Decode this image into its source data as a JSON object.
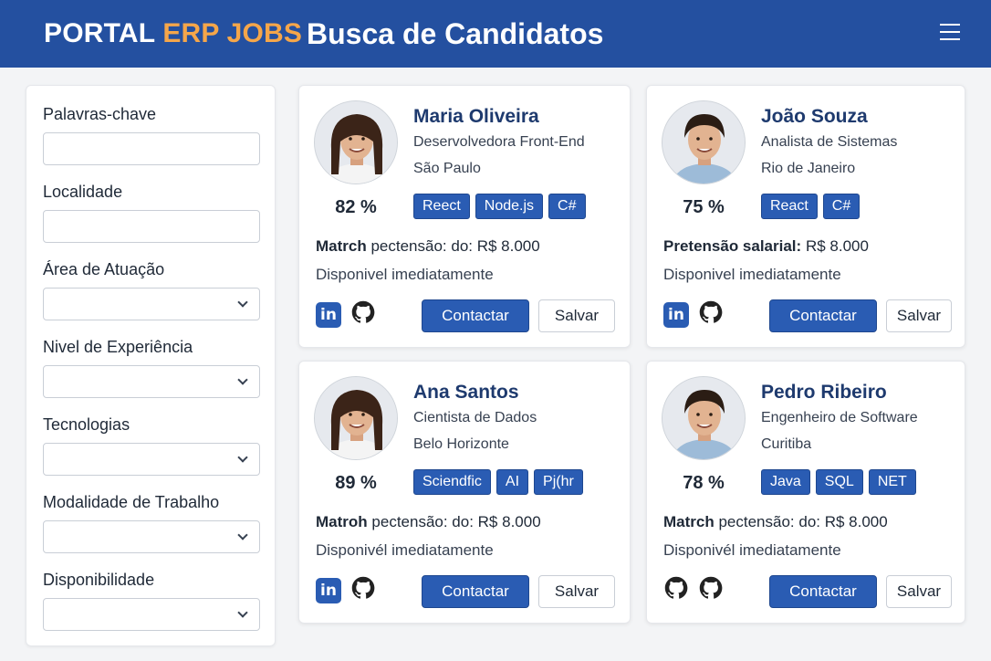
{
  "header": {
    "brand_part1": "PORTAL",
    "brand_part2": "ERP JOBS",
    "title": "Busca de Candidatos",
    "menu_icon": "hamburger-menu-icon"
  },
  "filters": [
    {
      "label": "Palavras-chave",
      "type": "text",
      "value": ""
    },
    {
      "label": "Localidade",
      "type": "text",
      "value": ""
    },
    {
      "label": "Área de Atuação",
      "type": "select",
      "value": ""
    },
    {
      "label": "Nivel de Experiência",
      "type": "select",
      "value": ""
    },
    {
      "label": "Tecnologias",
      "type": "select",
      "value": ""
    },
    {
      "label": "Modalidade de Trabalho",
      "type": "select",
      "value": ""
    },
    {
      "label": "Disponibilidade",
      "type": "select",
      "value": ""
    }
  ],
  "candidates": [
    {
      "name": "Maria Oliveira",
      "role": "Deservolvedora Front-End",
      "city": "São Paulo",
      "match": "82 %",
      "tags": [
        "Reect",
        "Node.js",
        "C#"
      ],
      "salary_label": "Matrch",
      "salary_text": "pectensão: do: R$ 8.000",
      "availability": "Disponivel imediatamente",
      "socials": [
        "linkedin-icon",
        "github-icon"
      ],
      "contact_label": "Contactar",
      "save_label": "Salvar"
    },
    {
      "name": "João Souza",
      "role": "Analista de Sistemas",
      "city": "Rio de Janeiro",
      "match": "75 %",
      "tags": [
        "React",
        "C#"
      ],
      "salary_label": "Pretensão salarial:",
      "salary_text": "R$ 8.000",
      "availability": "Disponivel imediatamente",
      "socials": [
        "linkedin-icon",
        "github-icon"
      ],
      "contact_label": "Contactar",
      "save_label": "Salvar"
    },
    {
      "name": "Ana Santos",
      "role": "Cientista de Dados",
      "city": "Belo Horizonte",
      "match": "89 %",
      "tags": [
        "Sciendfic",
        "AI",
        "Pj(hr"
      ],
      "salary_label": "Matroh",
      "salary_text": "pectensão: do: R$ 8.000",
      "availability": "Disponivél imediatamente",
      "socials": [
        "linkedin-icon",
        "github-icon"
      ],
      "contact_label": "Contactar",
      "save_label": "Salvar"
    },
    {
      "name": "Pedro Ribeiro",
      "role": "Engenheiro de Software",
      "city": "Curitiba",
      "match": "78 %",
      "tags": [
        "Java",
        "SQL",
        "NET"
      ],
      "salary_label": "Matrch",
      "salary_text": "pectensão: do: R$ 8.000",
      "availability": "Disponivél imediatamente",
      "socials": [
        "github-icon",
        "github-icon"
      ],
      "contact_label": "Contactar",
      "save_label": "Salvar"
    }
  ],
  "colors": {
    "header_bg": "#2450a0",
    "brand_accent": "#f5a64a",
    "primary": "#2a5cb3"
  }
}
